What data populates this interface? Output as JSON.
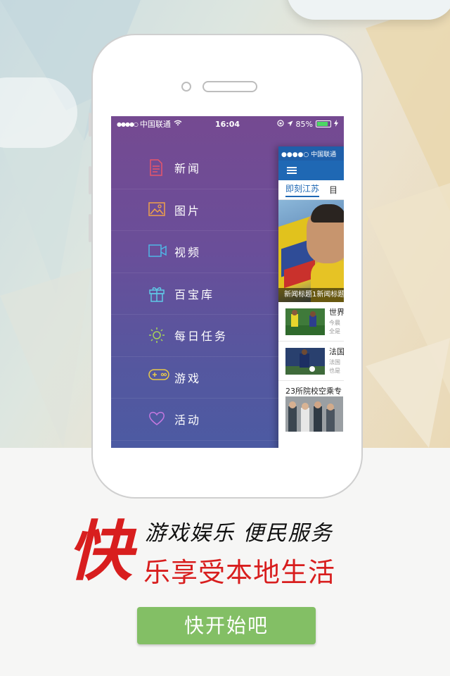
{
  "status_bar": {
    "signal": "●●●●○",
    "carrier": "中国联通",
    "time": "16:04",
    "battery_percent": "85%",
    "battery_level": 0.85
  },
  "menu": {
    "items": [
      {
        "label": "新闻",
        "icon": "news-doc-icon",
        "color": "#e8566b"
      },
      {
        "label": "图片",
        "icon": "image-icon",
        "color": "#f0a24a"
      },
      {
        "label": "视频",
        "icon": "video-camera-icon",
        "color": "#4fb7e6"
      },
      {
        "label": "百宝库",
        "icon": "gift-box-icon",
        "color": "#5fc9e6"
      },
      {
        "label": "每日任务",
        "icon": "sun-icon",
        "color": "#a6d35a"
      },
      {
        "label": "游戏",
        "icon": "gamepad-icon",
        "color": "#e8c94a"
      },
      {
        "label": "活动",
        "icon": "heart-icon",
        "color": "#c478e0"
      }
    ]
  },
  "preview": {
    "status_carrier": "●●●●○ 中国联通",
    "tab_active": "即刻江苏",
    "tab_other": "目",
    "hero_caption": "新闻标题1新闻标题",
    "news": [
      {
        "title": "世界",
        "sub1": "今晨",
        "sub2": "全是"
      },
      {
        "title": "法国",
        "sub1": "法国",
        "sub2": "也是"
      },
      {
        "title": "23所院校空乘专"
      }
    ]
  },
  "promo": {
    "big_char": "快",
    "slogan_line1": "游戏娱乐 便民服务",
    "slogan_line2": "乐享受本地生活",
    "start_button": "快开始吧"
  },
  "colors": {
    "accent_red": "#d81e1e",
    "button_green": "#83bf65",
    "nav_blue": "#1f68b4"
  }
}
